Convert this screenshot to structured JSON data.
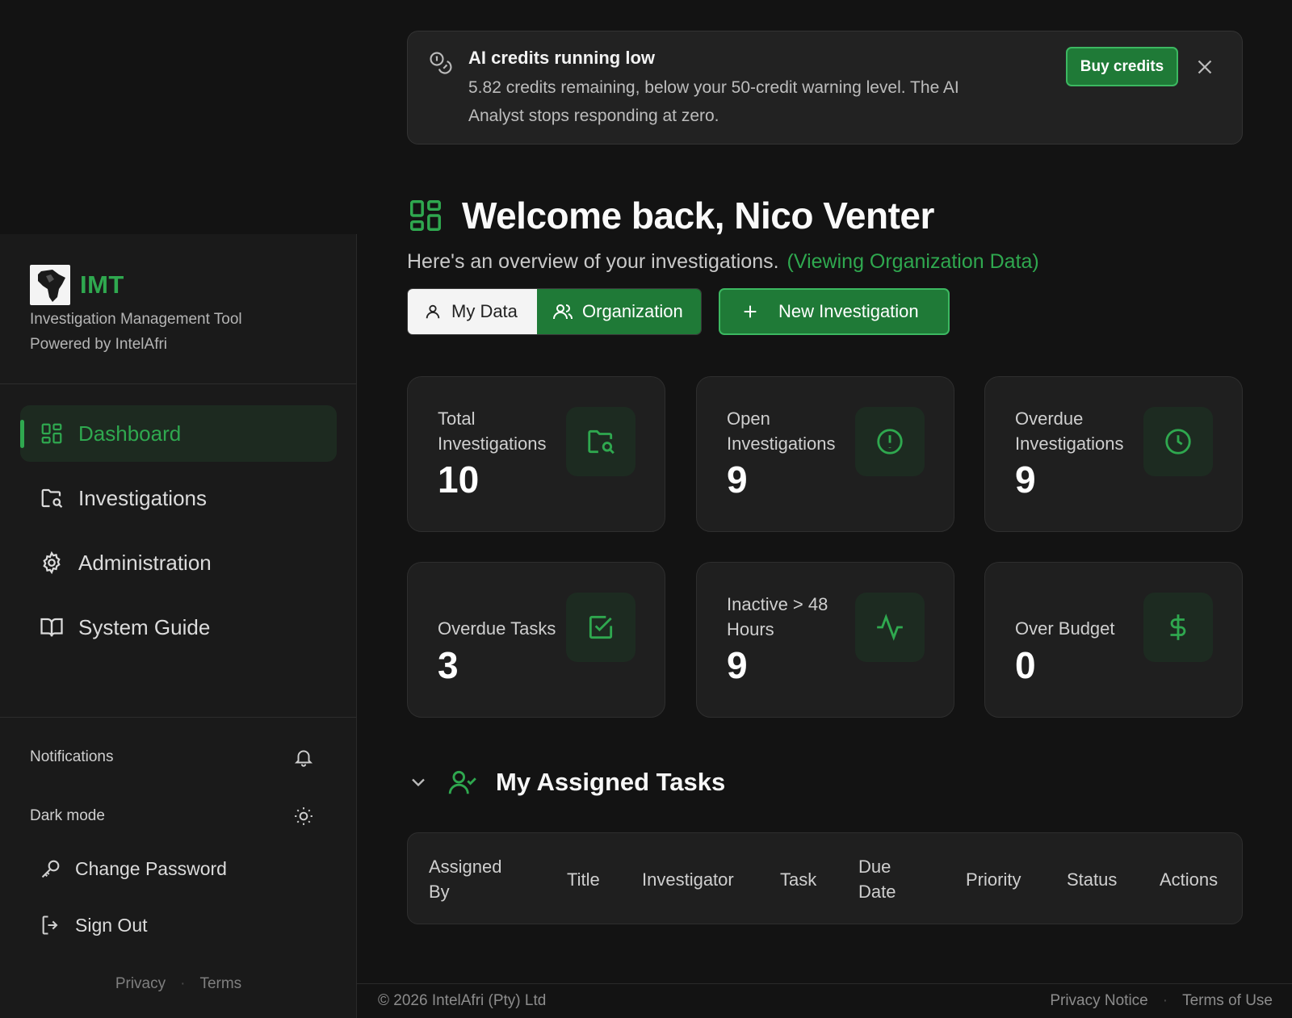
{
  "brand": {
    "name": "IMT",
    "subtitle": "Investigation Management Tool",
    "powered_by": "Powered by IntelAfri"
  },
  "sidebar": {
    "items": [
      {
        "label": "Dashboard",
        "icon": "dashboard-icon",
        "active": true
      },
      {
        "label": "Investigations",
        "icon": "folder-search-icon"
      },
      {
        "label": "Administration",
        "icon": "gear-icon"
      },
      {
        "label": "System Guide",
        "icon": "book-icon"
      }
    ],
    "notifications_label": "Notifications",
    "dark_mode_label": "Dark mode",
    "change_password_label": "Change Password",
    "sign_out_label": "Sign Out",
    "privacy_label": "Privacy",
    "terms_label": "Terms"
  },
  "banner": {
    "title": "AI credits running low",
    "message": "5.82 credits remaining, below your 50-credit warning level. The AI Analyst stops responding at zero.",
    "buy_label": "Buy credits"
  },
  "welcome": {
    "title": "Welcome back, Nico Venter",
    "subtitle": "Here's an overview of your investigations.",
    "org_note": "(Viewing Organization Data)"
  },
  "toggle": {
    "my_data_label": "My Data",
    "organization_label": "Organization"
  },
  "new_investigation_label": "New Investigation",
  "stats": [
    {
      "label": "Total Investigations",
      "value": "10",
      "icon": "folder-search-icon"
    },
    {
      "label": "Open Investigations",
      "value": "9",
      "icon": "alert-circle-icon"
    },
    {
      "label": "Overdue Investigations",
      "value": "9",
      "icon": "clock-icon"
    },
    {
      "label": "Overdue Tasks",
      "value": "3",
      "icon": "check-square-icon"
    },
    {
      "label": "Inactive > 48 Hours",
      "value": "9",
      "icon": "activity-icon"
    },
    {
      "label": "Over Budget",
      "value": "0",
      "icon": "dollar-icon"
    }
  ],
  "tasks": {
    "title": "My Assigned Tasks",
    "columns": [
      "Assigned By",
      "Title",
      "Investigator",
      "Task",
      "Due Date",
      "Priority",
      "Status",
      "Actions"
    ]
  },
  "footer": {
    "copyright": "© 2026 IntelAfri (Pty) Ltd",
    "privacy_notice": "Privacy Notice",
    "terms_of_use": "Terms of Use"
  },
  "colors": {
    "accent": "#2fa84f",
    "accent_dark": "#1f7a37",
    "background": "#131313",
    "panel": "#1f1f1f"
  }
}
